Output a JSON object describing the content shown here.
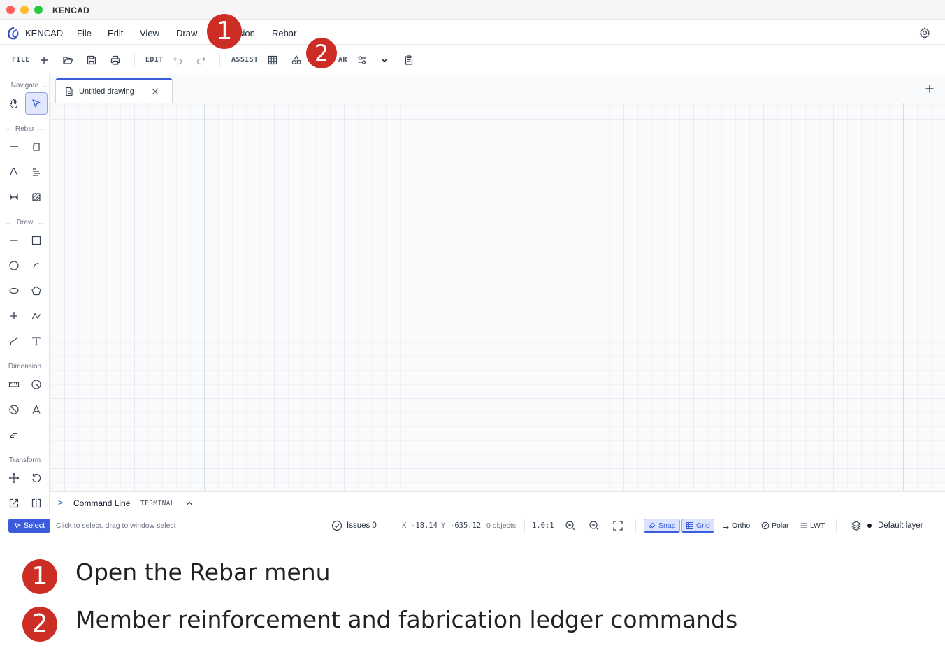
{
  "window": {
    "title": "KENCAD"
  },
  "menubar": {
    "app_name": "KENCAD",
    "items": [
      "File",
      "Edit",
      "View",
      "Draw",
      "Dimension",
      "Rebar"
    ],
    "occluded_visible_text": "sion"
  },
  "toolbar": {
    "file_label": "FILE",
    "edit_label": "EDIT",
    "assist_label": "ASSIST",
    "rebar_label": "AR"
  },
  "sidebar": {
    "sections": {
      "navigate": "Navigate",
      "rebar": "Rebar",
      "draw": "Draw",
      "dimension": "Dimension",
      "transform": "Transform"
    }
  },
  "tabs": {
    "active_doc": "Untitled drawing"
  },
  "command_line": {
    "prompt": ">_",
    "label": "Command Line",
    "tag": "TERMINAL"
  },
  "status": {
    "mode": "Select",
    "hint": "Click to select, drag to window select",
    "issues": "Issues 0",
    "x_label": "X",
    "x_value": "-18.14",
    "y_label": "Y",
    "y_value": "-635.12",
    "objects": "0 objects",
    "scale": "1.0:1",
    "snap": "Snap",
    "grid": "Grid",
    "ortho": "Ortho",
    "polar": "Polar",
    "lwt": "LWT",
    "layer": "Default layer"
  },
  "callouts": [
    {
      "number": "1",
      "text": "Open the Rebar menu"
    },
    {
      "number": "2",
      "text": "Member reinforcement and fabrication ledger commands"
    }
  ],
  "colors": {
    "accent": "#3b5bdb",
    "callout": "#cc2e26"
  }
}
